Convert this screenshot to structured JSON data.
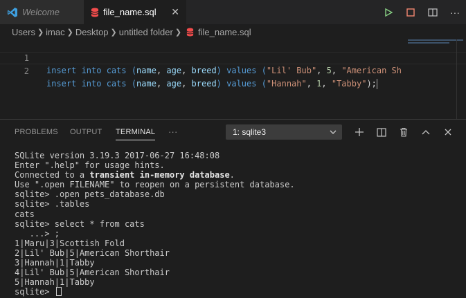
{
  "tabs": [
    {
      "label": "Welcome",
      "active": false
    },
    {
      "label": "file_name.sql",
      "active": true
    }
  ],
  "breadcrumb": [
    "Users",
    "imac",
    "Desktop",
    "untitled folder",
    "file_name.sql"
  ],
  "editor": {
    "lines": [
      {
        "number": "1",
        "prefix": "insert into cats (",
        "c1": "name",
        "s1": ", ",
        "c2": "age",
        "s2": ", ",
        "c3": "breed",
        "mid": ") values (",
        "v1": "\"Lil' Bub\"",
        "s3": ", ",
        "v2": "5",
        "s4": ", ",
        "v3": "\"American Sh",
        "end": ""
      },
      {
        "number": "2",
        "prefix": "insert into cats (",
        "c1": "name",
        "s1": ", ",
        "c2": "age",
        "s2": ", ",
        "c3": "breed",
        "mid": ") values (",
        "v1": "\"Hannah\"",
        "s3": ", ",
        "v2": "1",
        "s4": ", ",
        "v3": "\"Tabby\"",
        "end": ");"
      }
    ]
  },
  "panel": {
    "tabs": [
      "PROBLEMS",
      "OUTPUT",
      "TERMINAL"
    ],
    "active_tab": "TERMINAL",
    "more": "···",
    "terminal_select": "1: sqlite3"
  },
  "terminal": {
    "lines": [
      "SQLite version 3.19.3 2017-06-27 16:48:08",
      "Enter \".help\" for usage hints.",
      "Connected to a ",
      "Use \".open FILENAME\" to reopen on a persistent database.",
      "sqlite> .open pets_database.db",
      "sqlite> .tables",
      "cats",
      "sqlite> select * from cats",
      "   ...> ;",
      "1|Maru|3|Scottish Fold",
      "2|Lil' Bub|5|American Shorthair",
      "3|Hannah|1|Tabby",
      "4|Lil' Bub|5|American Shorthair",
      "5|Hannah|1|Tabby",
      "sqlite> "
    ],
    "bold_fragment": "transient in-memory database",
    "bold_suffix": "."
  },
  "colors": {
    "accent": "#007acc",
    "run": "#89d185",
    "stop": "#f48771",
    "sql_icon": "#f14c4c"
  }
}
